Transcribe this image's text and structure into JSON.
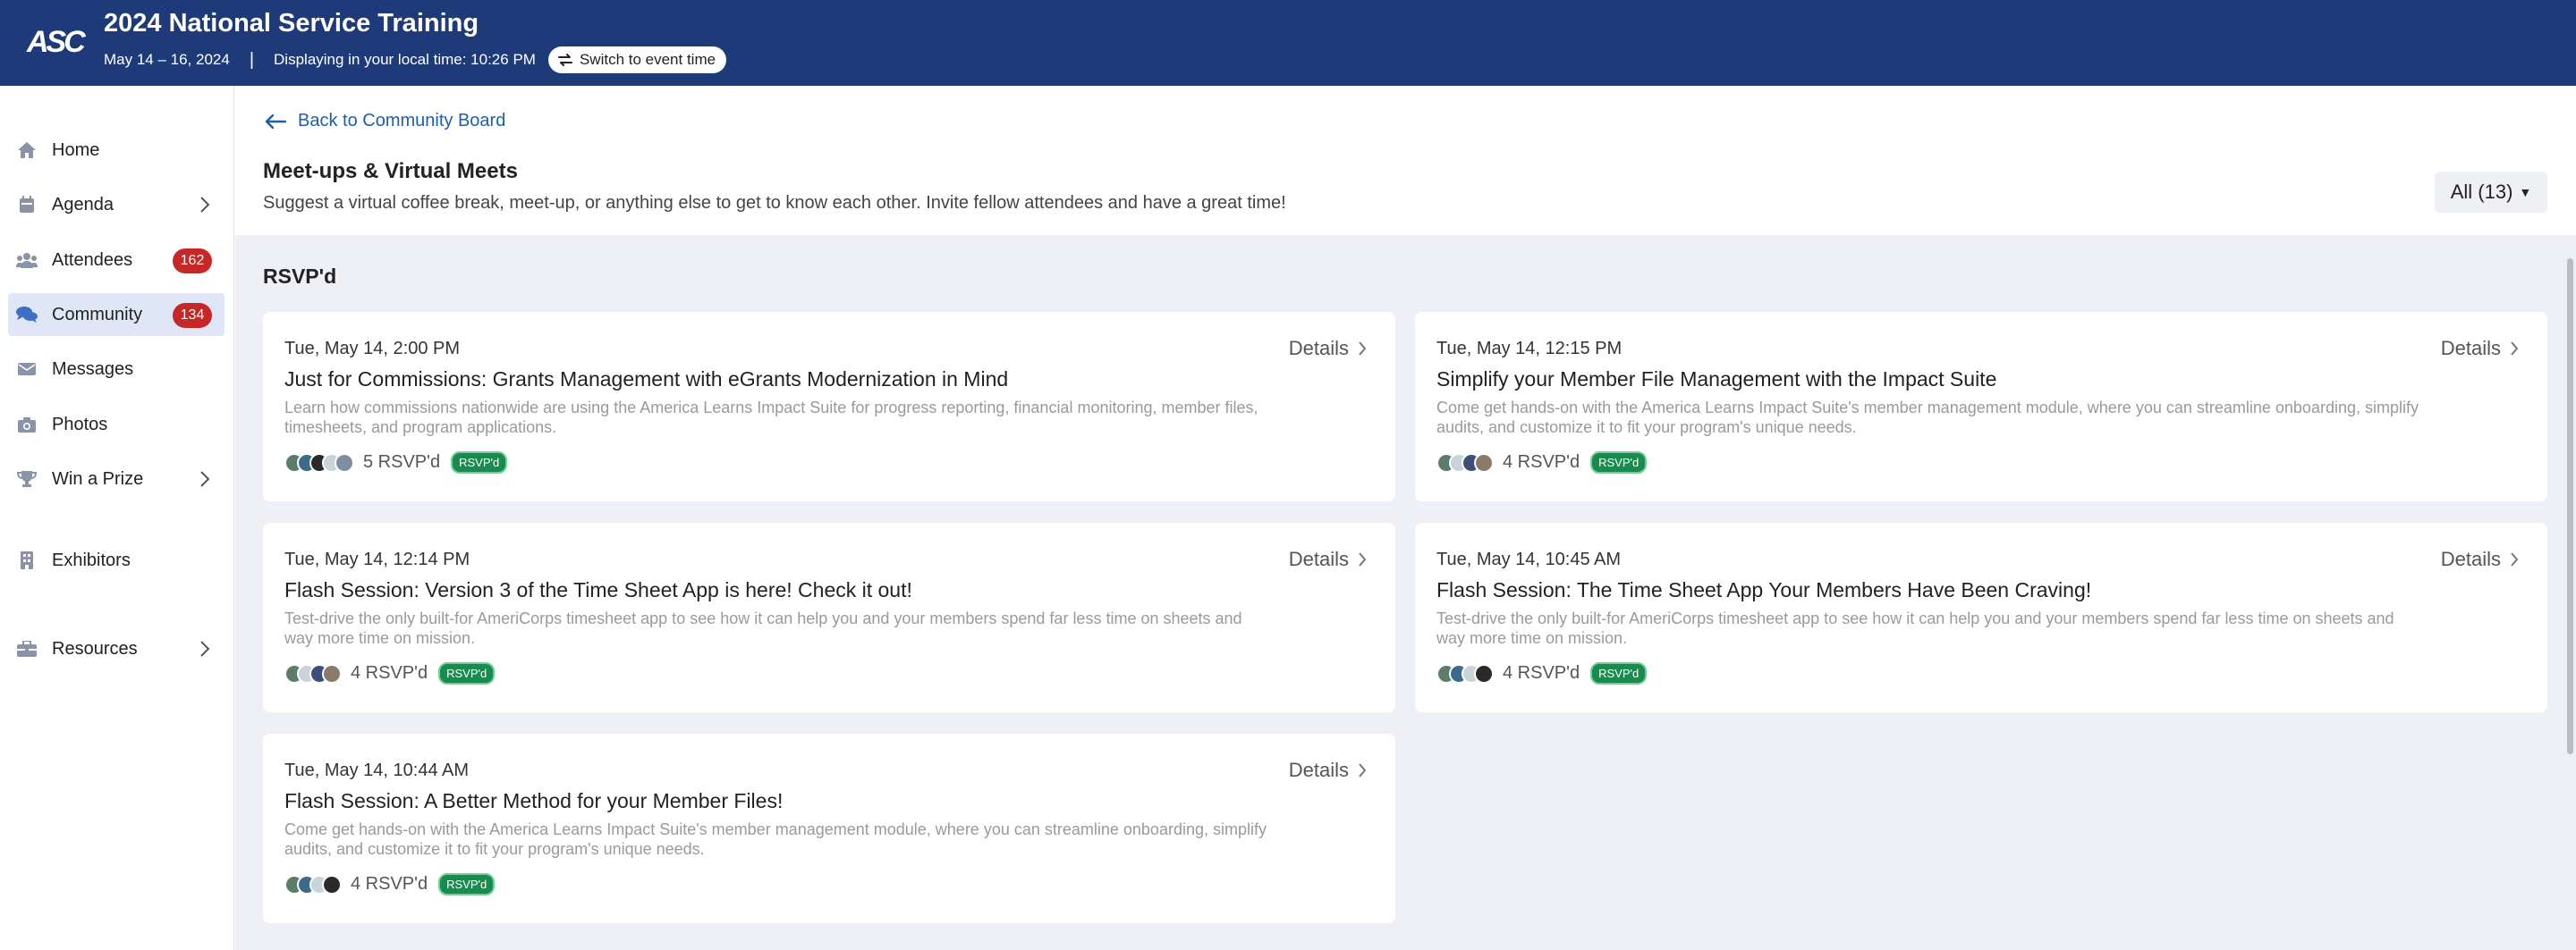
{
  "header": {
    "logo": "ASC",
    "title": "2024 National Service Training",
    "dates": "May 14 – 16, 2024",
    "separator": "|",
    "local_time": "Displaying in your local time: 10:26 PM",
    "switch_label": "Switch to event time"
  },
  "sidebar": {
    "items": [
      {
        "label": "Home",
        "icon": "home-icon"
      },
      {
        "label": "Agenda",
        "icon": "calendar-icon",
        "chevron": true
      },
      {
        "label": "Attendees",
        "icon": "users-icon",
        "badge": "162"
      },
      {
        "label": "Community",
        "icon": "chat-icon",
        "badge": "134",
        "active": true
      },
      {
        "label": "Messages",
        "icon": "envelope-icon"
      },
      {
        "label": "Photos",
        "icon": "camera-icon"
      },
      {
        "label": "Win a Prize",
        "icon": "trophy-icon",
        "chevron": true
      },
      {
        "label": "Exhibitors",
        "icon": "building-icon"
      },
      {
        "label": "Resources",
        "icon": "briefcase-icon",
        "chevron": true
      }
    ]
  },
  "main": {
    "back_label": "Back to Community Board",
    "section_title": "Meet-ups & Virtual Meets",
    "section_desc": "Suggest a virtual coffee break, meet-up, or anything else to get to know each other. Invite fellow attendees and have a great time!",
    "filter_label": "All (13)",
    "group_title": "RSVP'd",
    "details_label": "Details",
    "cards": [
      {
        "time": "Tue, May 14, 2:00 PM",
        "title": "Just for Commissions: Grants Management with eGrants Modernization in Mind",
        "desc": "Learn how commissions nationwide are using the America Learns Impact Suite for progress reporting, financial monitoring, member files, timesheets, and program applications.",
        "rsvp_count": "5 RSVP'd",
        "rsvp_badge": "RSVP'd",
        "avatars": 5
      },
      {
        "time": "Tue, May 14, 12:15 PM",
        "title": "Simplify your Member File Management with the Impact Suite",
        "desc": "Come get hands-on with the America Learns Impact Suite's member management module, where you can streamline onboarding, simplify audits, and customize it to fit your program's unique needs.",
        "rsvp_count": "4 RSVP'd",
        "rsvp_badge": "RSVP'd",
        "avatars": 4
      },
      {
        "time": "Tue, May 14, 12:14 PM",
        "title": "Flash Session: Version 3 of the Time Sheet App is here! Check it out!",
        "desc": "Test-drive the only built-for AmeriCorps timesheet app to see how it can help you and your members spend far less time on sheets and way more time on mission.",
        "rsvp_count": "4 RSVP'd",
        "rsvp_badge": "RSVP'd",
        "avatars": 4
      },
      {
        "time": "Tue, May 14, 10:45 AM",
        "title": "Flash Session: The Time Sheet App Your Members Have Been Craving!",
        "desc": "Test-drive the only built-for AmeriCorps timesheet app to see how it can help you and your members spend far less time on sheets and way more time on mission.",
        "rsvp_count": "4 RSVP'd",
        "rsvp_badge": "RSVP'd",
        "avatars": 4
      },
      {
        "time": "Tue, May 14, 10:44 AM",
        "title": "Flash Session: A Better Method for your Member Files!",
        "desc": "Come get hands-on with the America Learns Impact Suite's member management module, where you can streamline onboarding, simplify audits, and customize it to fit your program's unique needs.",
        "rsvp_count": "4 RSVP'd",
        "rsvp_badge": "RSVP'd",
        "avatars": 4
      }
    ]
  },
  "colors": {
    "header_bg": "#1e3a78",
    "link": "#1e5fa8",
    "badge_red": "#c62828",
    "rsvp_green": "#1a8a4f",
    "content_bg": "#eef0f5"
  }
}
